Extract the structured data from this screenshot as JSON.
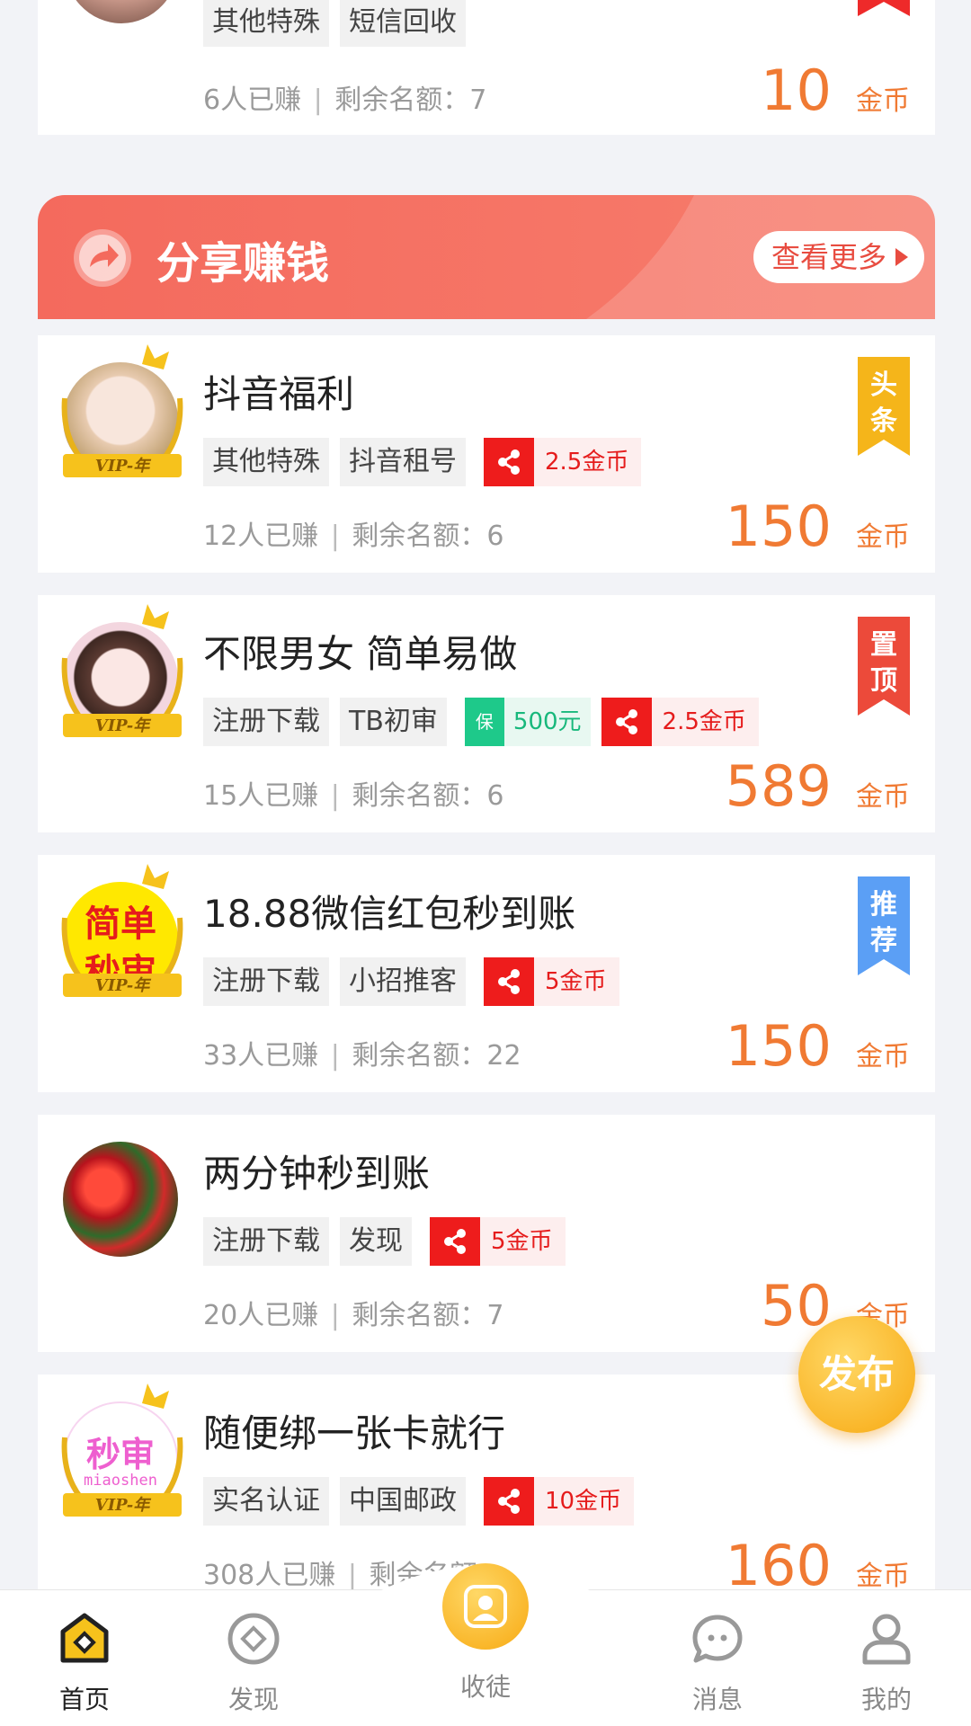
{
  "top_card": {
    "tags": [
      "其他特殊",
      "短信回收"
    ],
    "earned": "6人已赚",
    "quota": "剩余名额：7",
    "price": "10",
    "unit": "金币"
  },
  "share_section": {
    "title": "分享赚钱",
    "more_label": "查看更多"
  },
  "tasks": [
    {
      "title": "抖音福利",
      "tags": [
        "其他特殊",
        "抖音租号"
      ],
      "share_reward": "2.5金币",
      "earned": "12人已赚",
      "quota": "剩余名额：6",
      "price": "150",
      "unit": "金币",
      "badge": [
        "头",
        "条"
      ],
      "vip": "VIP-年"
    },
    {
      "title": "不限男女 简单易做",
      "tags": [
        "注册下载",
        "TB初审"
      ],
      "guarantee_icon": "保",
      "guarantee": "500元",
      "share_reward": "2.5金币",
      "earned": "15人已赚",
      "quota": "剩余名额：6",
      "price": "589",
      "unit": "金币",
      "badge": [
        "置",
        "顶"
      ],
      "vip": "VIP-年"
    },
    {
      "title": "18.88微信红包秒到账",
      "tags": [
        "注册下载",
        "小招推客"
      ],
      "share_reward": "5金币",
      "earned": "33人已赚",
      "quota": "剩余名额：22",
      "price": "150",
      "unit": "金币",
      "badge": [
        "推",
        "荐"
      ],
      "vip": "VIP-年",
      "avatar_text": [
        "简单",
        "秒审"
      ]
    },
    {
      "title": "两分钟秒到账",
      "tags": [
        "注册下载",
        "发现"
      ],
      "share_reward": "5金币",
      "earned": "20人已赚",
      "quota": "剩余名额：7",
      "price": "50",
      "unit": "金币"
    },
    {
      "title": "随便绑一张卡就行",
      "tags": [
        "实名认证",
        "中国邮政"
      ],
      "share_reward": "10金币",
      "earned": "308人已赚",
      "quota": "剩余名额",
      "price": "160",
      "unit": "金币",
      "vip": "VIP-年",
      "avatar_text": [
        "秒审",
        "miaoshen"
      ]
    }
  ],
  "publish_button": "发布",
  "nav": [
    {
      "label": "首页",
      "icon": "home-icon"
    },
    {
      "label": "发现",
      "icon": "discover-icon"
    },
    {
      "label": "收徒",
      "icon": "recruit-icon"
    },
    {
      "label": "消息",
      "icon": "message-icon"
    },
    {
      "label": "我的",
      "icon": "profile-icon"
    }
  ],
  "colors": {
    "price": "#f07a33",
    "share_red": "#ee1c1c",
    "banner": "#f46a5d",
    "guarantee": "#1ec98a",
    "publish": "#f7b21a"
  }
}
